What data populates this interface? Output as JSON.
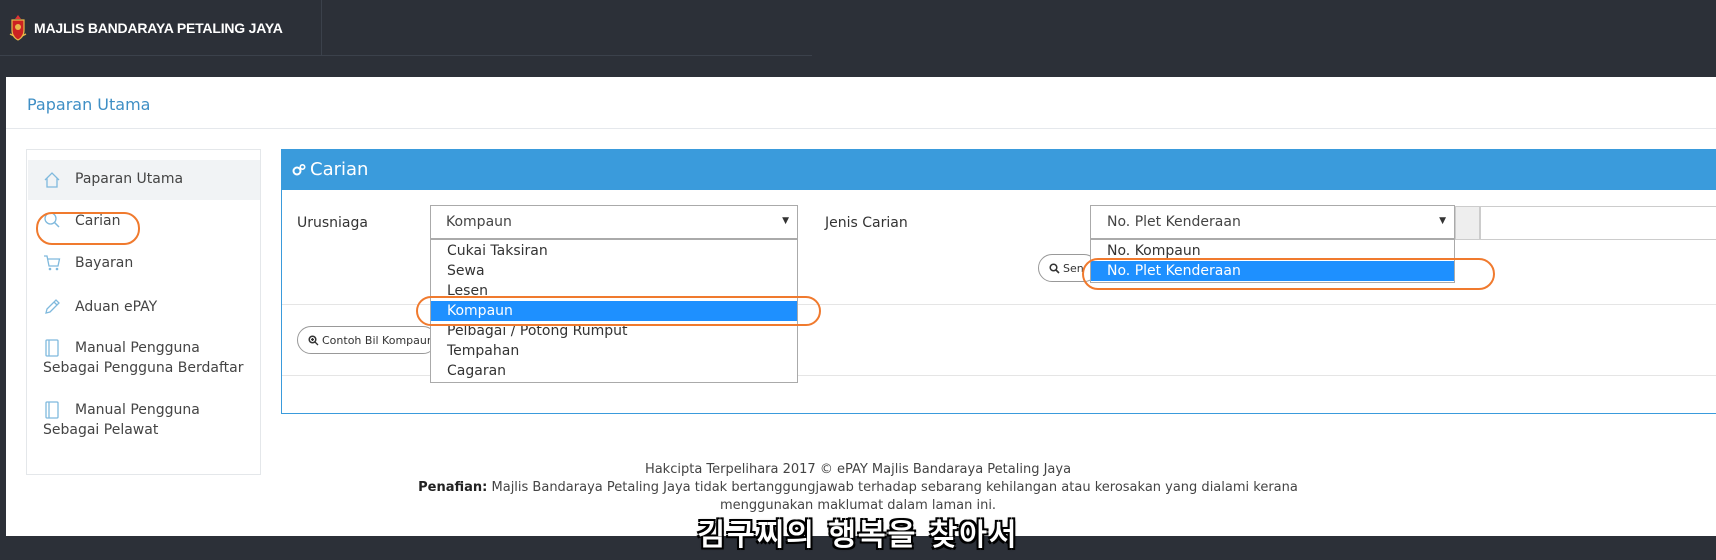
{
  "brand": {
    "name": "MAJLIS BANDARAYA PETALING JAYA"
  },
  "page": {
    "title": "Paparan Utama"
  },
  "sidebar": {
    "items": [
      {
        "label": "Paparan Utama",
        "icon": "home-icon"
      },
      {
        "label": "Carian",
        "icon": "search-icon"
      },
      {
        "label": "Bayaran",
        "icon": "cart-icon"
      },
      {
        "label": "Aduan ePAY",
        "icon": "pencil-icon"
      },
      {
        "label": "Manual Pengguna",
        "label2": "Sebagai Pengguna Berdaftar",
        "icon": "book-icon"
      },
      {
        "label": "Manual Pengguna",
        "label2": "Sebagai Pelawat",
        "icon": "book-icon"
      }
    ]
  },
  "panel": {
    "title": "Carian",
    "urusniaga": {
      "label": "Urusniaga",
      "value": "Kompaun",
      "options": [
        "Cukai Taksiran",
        "Sewa",
        "Lesen",
        "Kompaun",
        "Pelbagai / Potong Rumput",
        "Tempahan",
        "Cagaran"
      ],
      "selected": "Kompaun"
    },
    "jenis": {
      "label": "Jenis Carian",
      "value": "No. Plet Kenderaan",
      "options": [
        "No. Kompaun",
        "No. Plet Kenderaan"
      ],
      "selected": "No. Plet Kenderaan"
    },
    "search_button": "Sen",
    "sample_button": "Contoh Bil Kompaun"
  },
  "footer": {
    "copyright": "Hakcipta Terpelihara 2017 © ePAY Majlis Bandaraya Petaling Jaya",
    "disclaimer_label": "Penafian:",
    "disclaimer_text": " Majlis Bandaraya Petaling Jaya tidak bertanggungjawab terhadap sebarang kehilangan atau kerosakan yang dialami kerana",
    "disclaimer_text2": "menggunakan maklumat dalam laman ini."
  },
  "subtitle": "김구찌의 행복을 찾아서",
  "colors": {
    "accent": "#3a9bdc",
    "highlight": "#f07a2e",
    "selected": "#1e90ff",
    "topbar": "#2c3038"
  }
}
